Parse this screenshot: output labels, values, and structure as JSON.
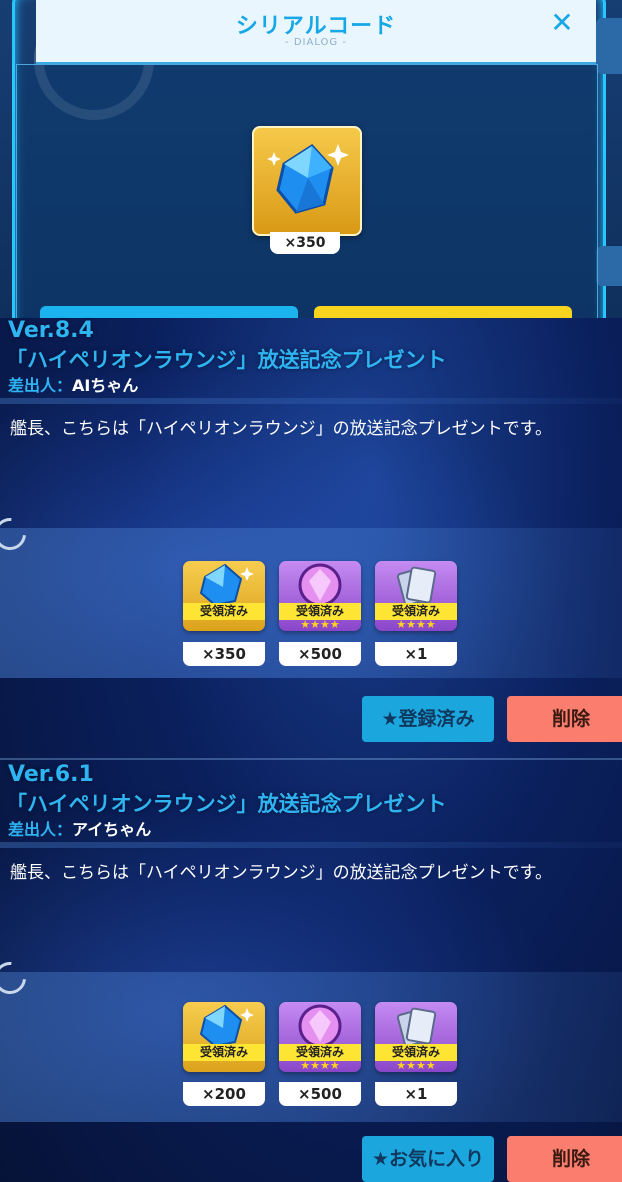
{
  "dialog": {
    "title": "シリアルコード",
    "subtitle": "- DIALOG -",
    "close_label": "✕",
    "prize": {
      "icon": "blue-crystal-icon",
      "quantity": "×350"
    }
  },
  "cards": [
    {
      "version": "Ver.8.4",
      "title": "「ハイペリオンラウンジ」放送記念プレゼント",
      "sender_label": "差出人：",
      "sender": "AIちゃん",
      "message": "艦長、こちらは「ハイペリオンラウンジ」の放送記念プレゼントです。",
      "items": [
        {
          "icon": "blue-crystal-icon",
          "badge": "受領済み",
          "stars": "",
          "quantity": "×350"
        },
        {
          "icon": "purple-orb-icon",
          "badge": "受領済み",
          "stars": "★★★★",
          "quantity": "×500"
        },
        {
          "icon": "silver-card-icon",
          "badge": "受領済み",
          "stars": "★★★★",
          "quantity": "×1"
        }
      ],
      "fav_label": "★登録済み",
      "delete_label": "削除"
    },
    {
      "version": "Ver.6.1",
      "title": "「ハイペリオンラウンジ」放送記念プレゼント",
      "sender_label": "差出人：",
      "sender": "アイちゃん",
      "message": "艦長、こちらは「ハイペリオンラウンジ」の放送記念プレゼントです。",
      "items": [
        {
          "icon": "blue-crystal-icon",
          "badge": "受領済み",
          "stars": "",
          "quantity": "×200"
        },
        {
          "icon": "purple-orb-icon",
          "badge": "受領済み",
          "stars": "★★★★",
          "quantity": "×500"
        },
        {
          "icon": "silver-card-icon",
          "badge": "受領済み",
          "stars": "★★★★",
          "quantity": "×1"
        }
      ],
      "fav_label": "★お気に入り",
      "delete_label": "削除"
    }
  ],
  "colors": {
    "accent_blue": "#2fb4f2",
    "badge_yellow": "#ffe533",
    "delete_salmon": "#fb7d6d",
    "fav_blue": "#1ba7de"
  }
}
